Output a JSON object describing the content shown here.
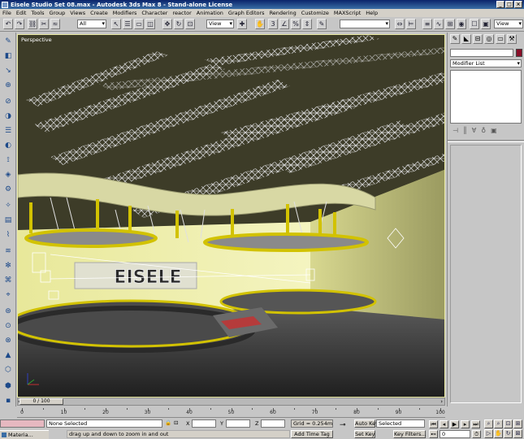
{
  "window": {
    "title": "Eisele Studio Set 08.max - Autodesk 3ds Max 8 - Stand-alone License"
  },
  "menu": [
    "File",
    "Edit",
    "Tools",
    "Group",
    "Views",
    "Create",
    "Modifiers",
    "Character",
    "reactor",
    "Animation",
    "Graph Editors",
    "Rendering",
    "Customize",
    "MAXScript",
    "Help"
  ],
  "toolbar": {
    "selection_filter": "All",
    "reference_coord": "View",
    "named_selection": "",
    "render_type": "View"
  },
  "viewport": {
    "label": "Perspective",
    "sign_text": "EISELE"
  },
  "command_panel": {
    "modifier_list": "Modifier List",
    "object_color": "#8a0e28"
  },
  "time_slider": {
    "label": "0 / 100",
    "position": 0
  },
  "track_bar": {
    "ticks": [
      "0",
      "10",
      "20",
      "30",
      "40",
      "50",
      "60",
      "70",
      "80",
      "90",
      "100"
    ]
  },
  "status": {
    "selection": "None Selected",
    "prompt": "drag up and down to zoom in and out",
    "x_label": "X",
    "y_label": "Y",
    "z_label": "Z",
    "grid": "Grid = 0.254m",
    "add_time_tag": "Add Time Tag",
    "auto_key": "Auto Key",
    "set_key": "Set Key",
    "key_mode": "Selected",
    "key_filters": "Key Filters...",
    "frame": "0"
  },
  "taskbar": {
    "item": "Materia..."
  }
}
